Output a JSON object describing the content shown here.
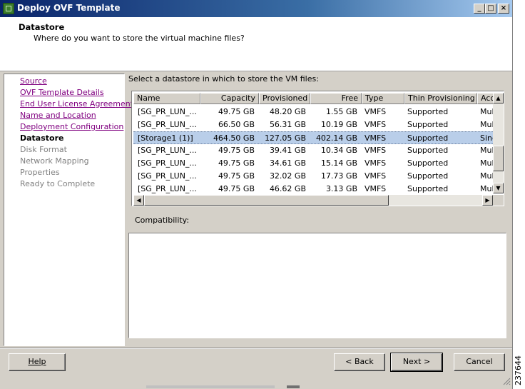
{
  "window": {
    "title": "Deploy OVF Template",
    "controls": [
      "_",
      "□",
      "×"
    ]
  },
  "header": {
    "title": "Datastore",
    "subtitle": "Where do you want to store the virtual machine files?"
  },
  "nav": {
    "items": [
      {
        "label": "Source",
        "state": "link"
      },
      {
        "label": "OVF Template Details",
        "state": "link"
      },
      {
        "label": "End User License Agreement",
        "state": "link"
      },
      {
        "label": "Name and Location",
        "state": "link"
      },
      {
        "label": "Deployment Configuration",
        "state": "link"
      },
      {
        "label": "Datastore",
        "state": "current"
      },
      {
        "label": "Disk Format",
        "state": "disabled"
      },
      {
        "label": "Network Mapping",
        "state": "disabled"
      },
      {
        "label": "Properties",
        "state": "disabled"
      },
      {
        "label": "Ready to Complete",
        "state": "disabled"
      }
    ]
  },
  "main": {
    "prompt": "Select a datastore in which to store the VM files:",
    "columns": [
      "Name",
      "Capacity",
      "Provisioned",
      "Free",
      "Type",
      "Thin Provisioning",
      "Acc"
    ],
    "rows": [
      {
        "name": "[SG_PR_LUN_...",
        "capacity": "49.75 GB",
        "provisioned": "48.20 GB",
        "free": "1.55 GB",
        "type": "VMFS",
        "thin": "Supported",
        "access": "Mult",
        "selected": false
      },
      {
        "name": "[SG_PR_LUN_...",
        "capacity": "66.50 GB",
        "provisioned": "56.31 GB",
        "free": "10.19 GB",
        "type": "VMFS",
        "thin": "Supported",
        "access": "Mult",
        "selected": false
      },
      {
        "name": "[Storage1 (1)]",
        "capacity": "464.50 GB",
        "provisioned": "127.05 GB",
        "free": "402.14 GB",
        "type": "VMFS",
        "thin": "Supported",
        "access": "Sing",
        "selected": true
      },
      {
        "name": "[SG_PR_LUN_...",
        "capacity": "49.75 GB",
        "provisioned": "39.41 GB",
        "free": "10.34 GB",
        "type": "VMFS",
        "thin": "Supported",
        "access": "Mult",
        "selected": false
      },
      {
        "name": "[SG_PR_LUN_...",
        "capacity": "49.75 GB",
        "provisioned": "34.61 GB",
        "free": "15.14 GB",
        "type": "VMFS",
        "thin": "Supported",
        "access": "Mult",
        "selected": false
      },
      {
        "name": "[SG_PR_LUN_...",
        "capacity": "49.75 GB",
        "provisioned": "32.02 GB",
        "free": "17.73 GB",
        "type": "VMFS",
        "thin": "Supported",
        "access": "Mult",
        "selected": false
      },
      {
        "name": "[SG_PR_LUN_...",
        "capacity": "49.75 GB",
        "provisioned": "46.62 GB",
        "free": "3.13 GB",
        "type": "VMFS",
        "thin": "Supported",
        "access": "Mult",
        "selected": false
      }
    ],
    "compatibility_label": "Compatibility:",
    "compatibility_text": ""
  },
  "footer": {
    "help": "Help",
    "back": "< Back",
    "next": "Next >",
    "cancel": "Cancel"
  },
  "figure_id": "237644",
  "colors": {
    "selection": "#b9cee9",
    "visited_link": "#800080",
    "titlebar": "#0a246a"
  }
}
